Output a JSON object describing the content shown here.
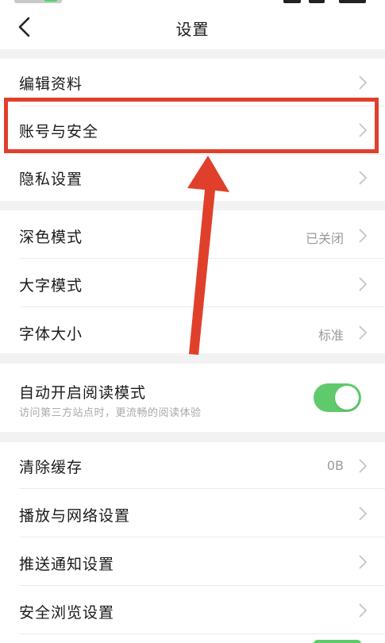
{
  "header": {
    "title": "设置",
    "back_icon": "chevron-left-icon"
  },
  "settings": {
    "edit_profile": "编辑资料",
    "account_security": "账号与安全",
    "privacy": "隐私设置",
    "dark_mode": {
      "label": "深色模式",
      "value": "已关闭"
    },
    "large_text_mode": "大字模式",
    "font_size": {
      "label": "字体大小",
      "value": "标准"
    },
    "auto_reading_mode": {
      "label": "自动开启阅读模式",
      "description": "访问第三方站点时，更流畅的阅读体验",
      "enabled": true
    },
    "clear_cache": {
      "label": "清除缓存",
      "value": "0B"
    },
    "playback_network": "播放与网络设置",
    "push_notifications": "推送通知设置",
    "safe_browsing": "安全浏览设置"
  },
  "annotation": {
    "highlight_color": "#e0402b",
    "points_to": "账号与安全"
  },
  "colors": {
    "toggle_on": "#5fca6b",
    "section_gap": "#f2f2f2",
    "secondary_text": "#9a9a9a"
  }
}
